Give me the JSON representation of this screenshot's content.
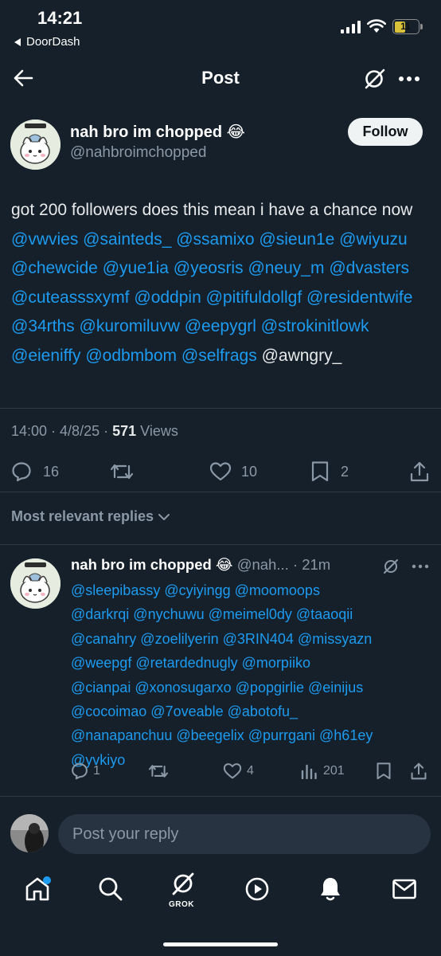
{
  "status_bar": {
    "time": "14:21",
    "back_app": "DoorDash",
    "battery": "11"
  },
  "header": {
    "title": "Post",
    "icons": [
      "back-arrow-icon",
      "grok-icon",
      "more-icon"
    ]
  },
  "post": {
    "author_name": "nah bro im chopped 😂",
    "author_handle": "@nahbroimchopped",
    "follow_label": "Follow",
    "text_intro": "got 200 followers does this mean i have a chance now",
    "mentions": [
      "@vwvies",
      "@sainteds_",
      "@ssamixo",
      "@sieun1e",
      "@wiyuzu",
      "@chewcide",
      "@yue1ia",
      "@yeosris",
      "@neuy_m",
      "@dvasters",
      "@cuteasssxymf",
      "@oddpin",
      "@pitifuldollgf",
      "@residentwife",
      "@34rths",
      "@kuromiluvw",
      "@eepygrl",
      "@strokinitlowk",
      "@eieniffy",
      "@odbmbom",
      "@selfrags"
    ],
    "last_mention": "@awngry_",
    "time": "14:00",
    "date": "4/8/25",
    "views_count": "571",
    "views_label": "Views",
    "replies": "16",
    "likes": "10",
    "bookmarks": "2"
  },
  "replies_filter": "Most relevant replies",
  "reply": {
    "author_name": "nah bro im chopped 😂",
    "handle": "@nah...",
    "time": "21m",
    "lines": [
      "@sleepibassy @cyiyingg @moomoops",
      "@darkrqi @nychuwu @meimel0dy @taaoqii",
      "@canahry @zoelilyerin @3RIN404 @missyazn",
      "@weepgf @retardednugly @morpiiko",
      "@cianpai @xonosugarxo @popgirlie @einijus",
      "@cocoimao @7oveable @abotofu_",
      "@nanapanchuu @beegelix @purrgani @h61ey",
      "@yvkiyo"
    ],
    "replies": "1",
    "likes": "4",
    "views": "201"
  },
  "composer": {
    "placeholder": "Post your reply"
  },
  "tab_bar": {
    "grok_label": "GROK",
    "icons": [
      "home-icon",
      "search-icon",
      "grok-icon",
      "play-icon",
      "bell-icon",
      "mail-icon"
    ]
  },
  "colors": {
    "background": "#15202b",
    "accent": "#1d9bf0",
    "muted": "#8b98a5"
  }
}
